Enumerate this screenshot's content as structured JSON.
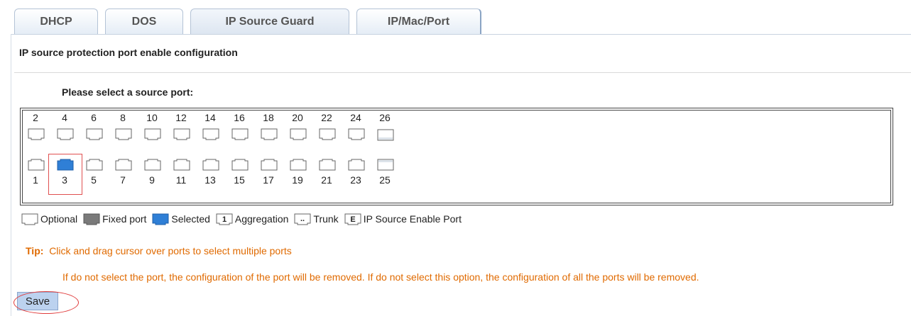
{
  "tabs": [
    {
      "label": "DHCP"
    },
    {
      "label": "DOS"
    },
    {
      "label": "IP Source Guard"
    },
    {
      "label": "IP/Mac/Port"
    }
  ],
  "active_tab": "IP Source Guard",
  "section_title": "IP source protection port enable configuration",
  "prompt": "Please select a source port:",
  "ports": {
    "top_row": [
      "2",
      "4",
      "6",
      "8",
      "10",
      "12",
      "14",
      "16",
      "18",
      "20",
      "22",
      "24",
      "26"
    ],
    "bottom_row": [
      "1",
      "3",
      "5",
      "7",
      "9",
      "11",
      "13",
      "15",
      "17",
      "19",
      "21",
      "23",
      "25"
    ],
    "selected": [
      "3"
    ],
    "fiber_ports": [
      "25",
      "26"
    ]
  },
  "legend": [
    {
      "icon": "port-optional-icon",
      "label": "Optional"
    },
    {
      "icon": "port-fixed-icon",
      "label": "Fixed port"
    },
    {
      "icon": "port-selected-icon",
      "label": "Selected"
    },
    {
      "icon": "port-aggregation-icon",
      "glyph": "1",
      "label": "Aggregation"
    },
    {
      "icon": "port-trunk-icon",
      "glyph": "..",
      "label": "Trunk"
    },
    {
      "icon": "port-ip-source-icon",
      "glyph": "E",
      "label": "IP Source Enable Port"
    }
  ],
  "tip": {
    "prefix": "Tip:",
    "text": "Click and drag cursor over ports to select multiple ports"
  },
  "note": "If do not select the port, the configuration of the port will be removed. If do not select this option, the configuration of all the ports will be removed.",
  "save_label": "Save",
  "colors": {
    "selected": "#2f7fd6",
    "fixed": "#7a7a7a",
    "tip": "#e06a00",
    "highlight": "#e03c3c"
  }
}
